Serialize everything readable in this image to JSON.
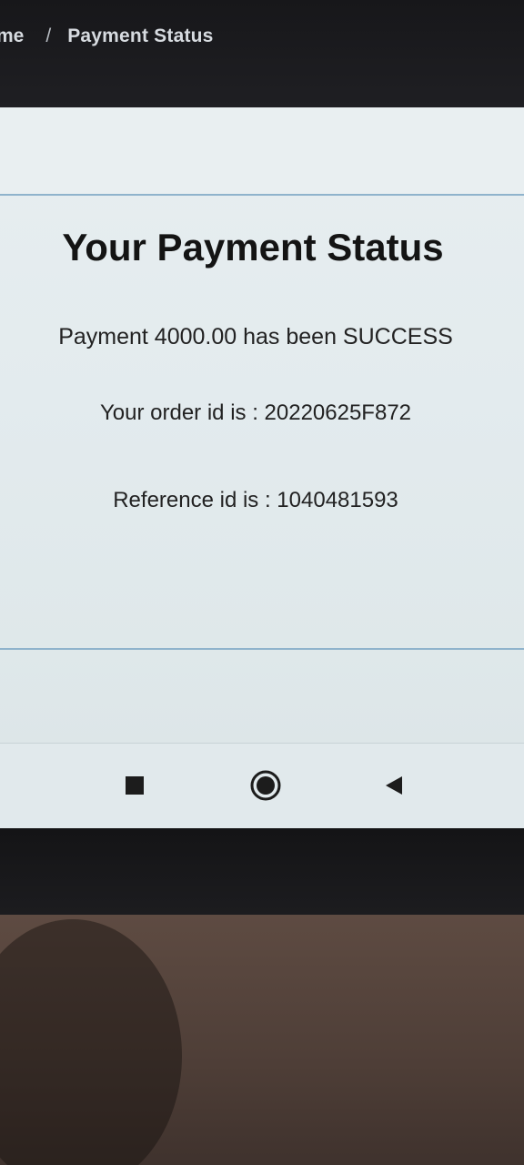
{
  "breadcrumb": {
    "home": "me",
    "separator": "/",
    "current": "Payment Status"
  },
  "status": {
    "title": "Your Payment Status",
    "payment_line": "Payment 4000.00 has been SUCCESS",
    "order_line": "Your order id is : 20220625F872",
    "reference_line": "Reference id is : 1040481593"
  },
  "navbar": {
    "recents_icon": "square-icon",
    "home_icon": "circle-home-icon",
    "back_icon": "back-triangle-icon"
  },
  "colors": {
    "screen_bg": "#e5ecef",
    "text": "#141414",
    "rule": "#8fb3cc"
  }
}
